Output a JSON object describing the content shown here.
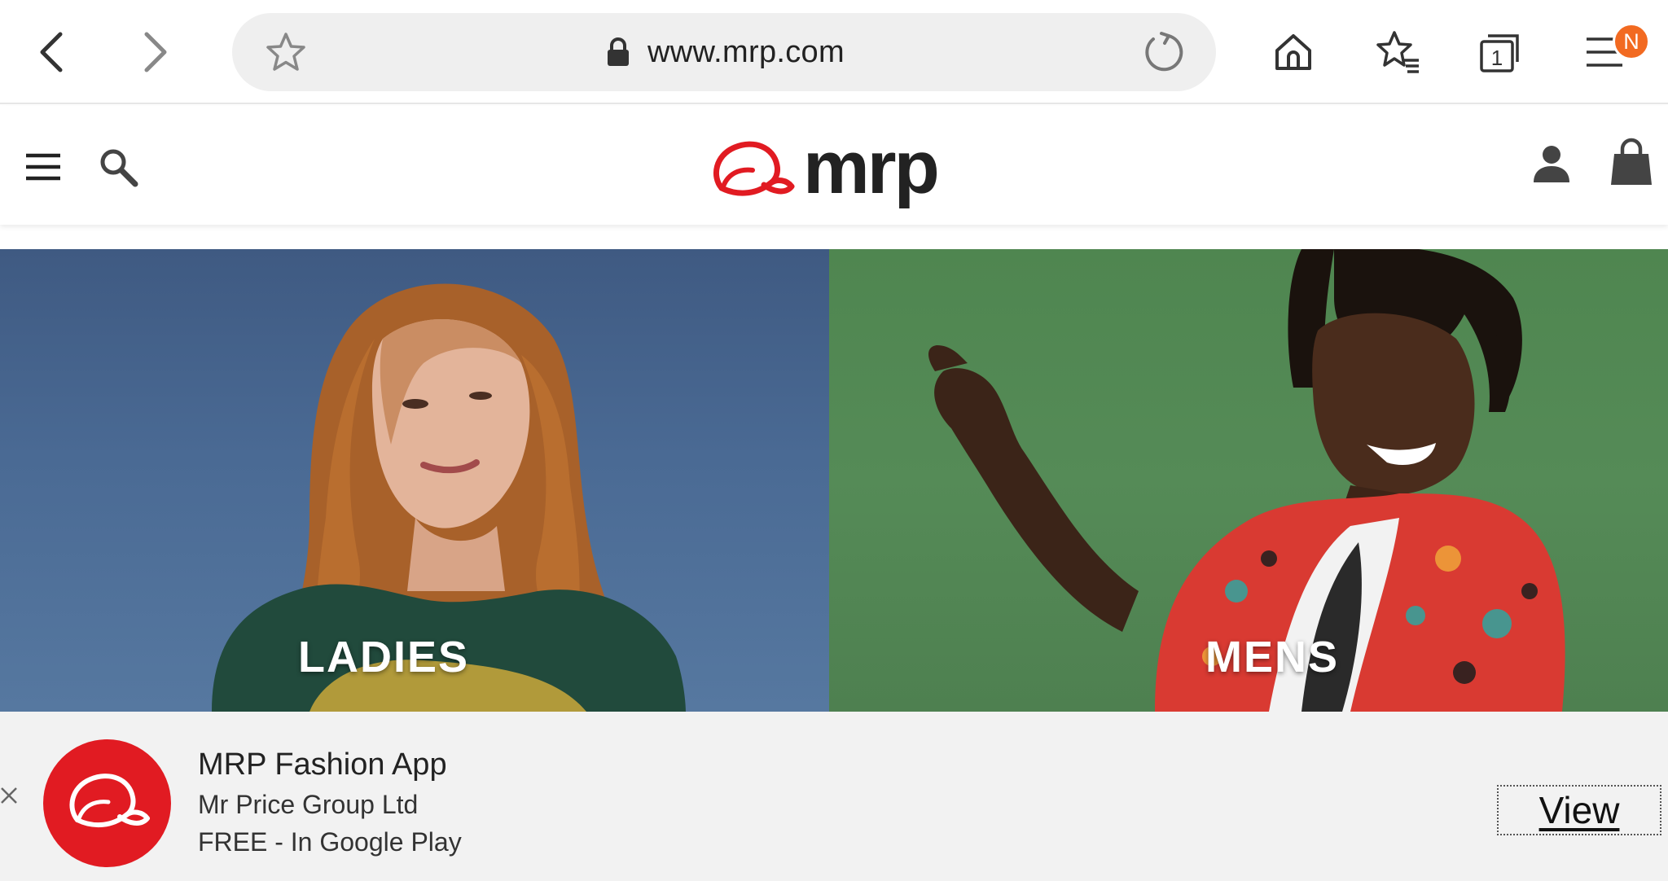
{
  "browser": {
    "url": "www.mrp.com",
    "tab_count": "1",
    "profile_badge": "N",
    "icons": {
      "back": "chevron-left-icon",
      "forward": "chevron-right-icon",
      "bookmark": "star-icon",
      "lock": "lock-icon",
      "reload": "reload-icon",
      "home": "home-icon",
      "bookmarks": "bookmarks-list-icon",
      "tabs": "tabs-icon",
      "menu": "menu-icon"
    },
    "colors": {
      "badge": "#f26a21"
    }
  },
  "site": {
    "logo_text": "mrp",
    "colors": {
      "brand_red": "#e11b22",
      "logo_text": "#222222"
    },
    "icons": {
      "menu": "hamburger-icon",
      "search": "search-icon",
      "account": "user-icon",
      "cart": "shopping-bag-icon"
    }
  },
  "hero": {
    "left_label": "LADIES",
    "right_label": "MENS",
    "colors": {
      "ladies_bg": "#4a6a94",
      "mens_bg": "#558b57"
    }
  },
  "app_banner": {
    "title": "MRP Fashion App",
    "publisher": "Mr Price Group Ltd",
    "price_store": "FREE - In Google Play",
    "view_label": "View",
    "icons": {
      "close": "close-icon",
      "app": "cap-logo-icon"
    }
  }
}
